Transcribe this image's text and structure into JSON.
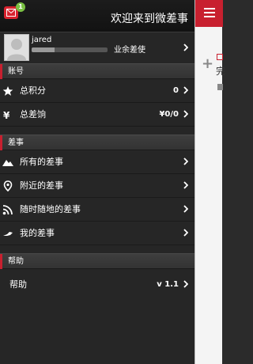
{
  "header": {
    "welcome": "欢迎来到微差事",
    "mail_badge": "1"
  },
  "user": {
    "name": "jared",
    "rank": "业余差使",
    "progress": 0.3
  },
  "sections": {
    "account": "账号",
    "tasks": "差事",
    "help": "帮助"
  },
  "account_items": [
    {
      "label": "总积分",
      "value": "0"
    },
    {
      "label": "总差饷",
      "value": "¥0/0"
    }
  ],
  "task_items": [
    {
      "label": "所有的差事"
    },
    {
      "label": "附近的差事"
    },
    {
      "label": "随时随地的差事"
    },
    {
      "label": "我的差事"
    }
  ],
  "help_items": [
    {
      "label": "帮助",
      "value": "v 1.1"
    }
  ],
  "side_panel": {
    "partial_char": "完"
  },
  "colors": {
    "accent": "#c8202f",
    "badge": "#7ac143",
    "drawer_bg": "#262626"
  }
}
